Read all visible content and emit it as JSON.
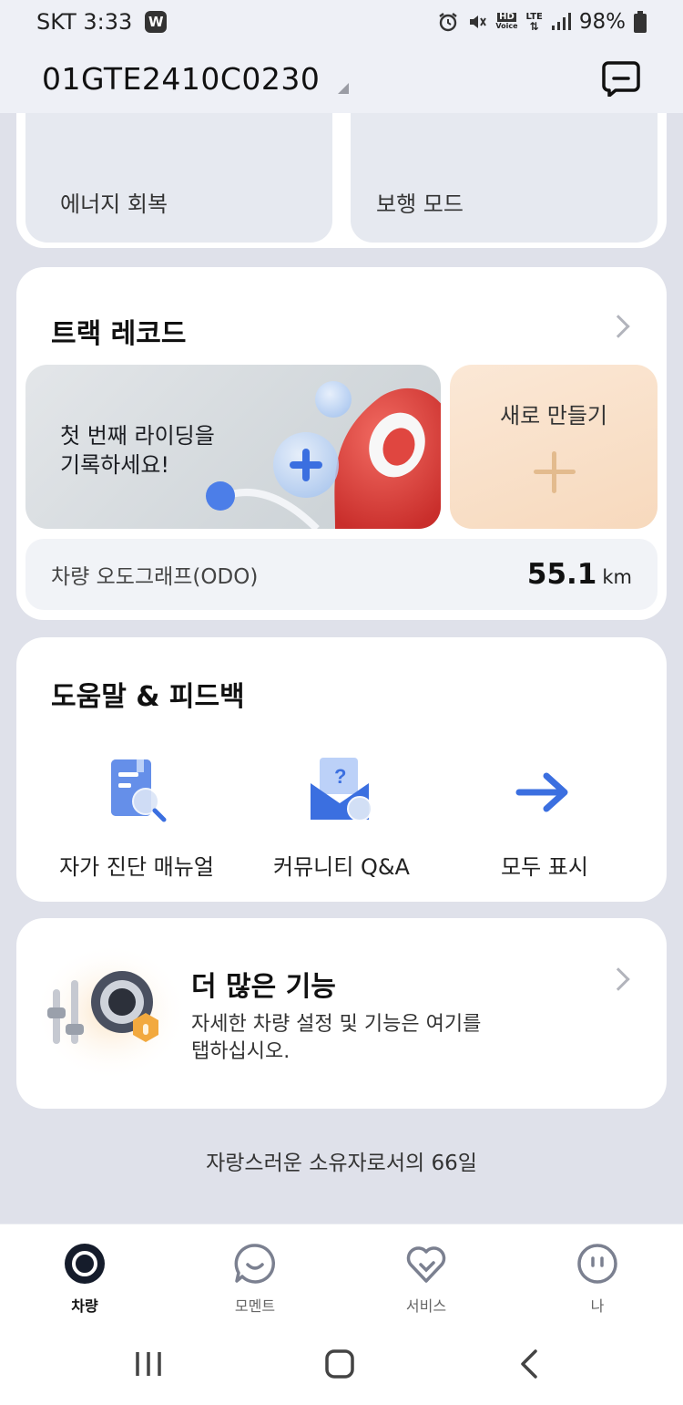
{
  "status_bar": {
    "carrier_time": "SKT 3:33",
    "app_badge": "W",
    "hd_label": "HD",
    "voice_label": "Voice",
    "lte_label": "LTE",
    "battery": "98%"
  },
  "header": {
    "vehicle_id": "01GTE2410C0230"
  },
  "quick_tiles": [
    {
      "label": "에너지 회복"
    },
    {
      "label": "보행 모드"
    }
  ],
  "track_record": {
    "title": "트랙 레코드",
    "first_ride_line1": "첫 번째 라이딩을",
    "first_ride_line2": "기록하세요!",
    "new_label": "새로 만들기",
    "odo_label": "차량 오도그래프(ODO)",
    "odo_value": "55.1",
    "odo_unit": "km"
  },
  "help": {
    "title": "도움말 & 피드백",
    "items": [
      {
        "label": "자가 진단 매뉴얼"
      },
      {
        "label": "커뮤니티 Q&A"
      },
      {
        "label": "모두 표시"
      }
    ]
  },
  "more": {
    "title": "더 많은 기능",
    "desc_line1": "자세한 차량 설정 및 기능은 여기를",
    "desc_line2": "탭하십시오."
  },
  "ownership": "자랑스러운 소유자로서의 66일",
  "nav": [
    {
      "label": "차량",
      "icon": "vehicle-icon",
      "active": true
    },
    {
      "label": "모멘트",
      "icon": "moment-icon",
      "active": false
    },
    {
      "label": "서비스",
      "icon": "service-icon",
      "active": false
    },
    {
      "label": "나",
      "icon": "me-icon",
      "active": false
    }
  ],
  "colors": {
    "background": "#dfe1ea",
    "accent_blue": "#3b6fe0",
    "new_tile": "#f7d9bd",
    "pin_red": "#e0433f"
  }
}
